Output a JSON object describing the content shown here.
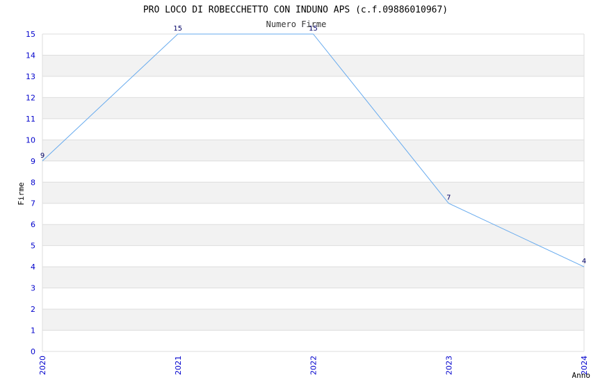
{
  "chart_data": {
    "type": "line",
    "title": "PRO LOCO DI ROBECCHETTO CON INDUNO APS (c.f.09886010967)",
    "subtitle": "Numero Firme",
    "xlabel": "Anno",
    "ylabel": "Firme",
    "x": [
      "2020",
      "2021",
      "2022",
      "2023",
      "2024"
    ],
    "series": [
      {
        "values": [
          9,
          15,
          15,
          7,
          4
        ]
      }
    ],
    "ylim": [
      0,
      15
    ],
    "yticks": [
      0,
      1,
      2,
      3,
      4,
      5,
      6,
      7,
      8,
      9,
      10,
      11,
      12,
      13,
      14,
      15
    ],
    "grid": true,
    "legend": "none",
    "colors": {
      "line": "#66aaee",
      "band": "#f2f2f2",
      "gridline": "#dddddd",
      "tick_text": "#0000cc",
      "label_text": "#000066"
    }
  }
}
